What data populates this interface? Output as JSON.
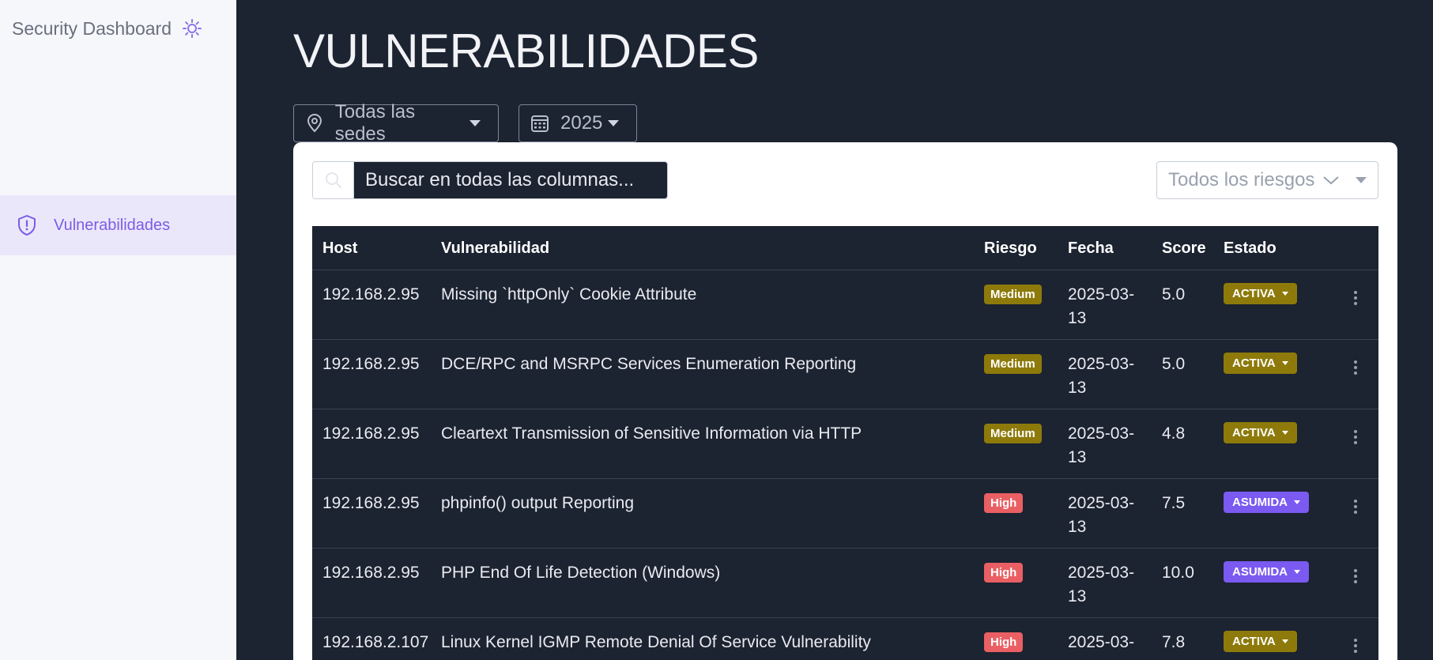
{
  "sidebar": {
    "brand_title": "Security Dashboard",
    "items": [
      {
        "label": "Vulnerabilidades",
        "icon": "shield-alert-icon",
        "active": true
      }
    ]
  },
  "main": {
    "title": "VULNERABILIDADES",
    "filters": {
      "site": "Todas las sedes",
      "year": "2025"
    },
    "search": {
      "placeholder": "Buscar en todas las columnas..."
    },
    "risk_filter": "Todos los riesgos",
    "table": {
      "headers": {
        "host": "Host",
        "vuln": "Vulnerabilidad",
        "risk": "Riesgo",
        "date": "Fecha",
        "score": "Score",
        "status": "Estado"
      },
      "rows": [
        {
          "host": "192.168.2.95",
          "vuln": "Missing `httpOnly` Cookie Attribute",
          "risk": "Medium",
          "date": "2025-03-13",
          "score": "5.0",
          "status": "ACTIVA"
        },
        {
          "host": "192.168.2.95",
          "vuln": "DCE/RPC and MSRPC Services Enumeration Reporting",
          "risk": "Medium",
          "date": "2025-03-13",
          "score": "5.0",
          "status": "ACTIVA"
        },
        {
          "host": "192.168.2.95",
          "vuln": "Cleartext Transmission of Sensitive Information via HTTP",
          "risk": "Medium",
          "date": "2025-03-13",
          "score": "4.8",
          "status": "ACTIVA"
        },
        {
          "host": "192.168.2.95",
          "vuln": "phpinfo() output Reporting",
          "risk": "High",
          "date": "2025-03-13",
          "score": "7.5",
          "status": "ASUMIDA"
        },
        {
          "host": "192.168.2.95",
          "vuln": "PHP End Of Life Detection (Windows)",
          "risk": "High",
          "date": "2025-03-13",
          "score": "10.0",
          "status": "ASUMIDA"
        },
        {
          "host": "192.168.2.107",
          "vuln": "Linux Kernel IGMP Remote Denial Of Service Vulnerability",
          "risk": "High",
          "date": "2025-03-",
          "score": "7.8",
          "status": "ACTIVA"
        }
      ]
    }
  },
  "colors": {
    "sidebar_bg": "#f6f7fb",
    "main_bg": "#1c2331",
    "accent": "#7b5ce6",
    "medium": "#8d7a0a",
    "high": "#ea5f63",
    "asumida": "#7a5af0"
  }
}
